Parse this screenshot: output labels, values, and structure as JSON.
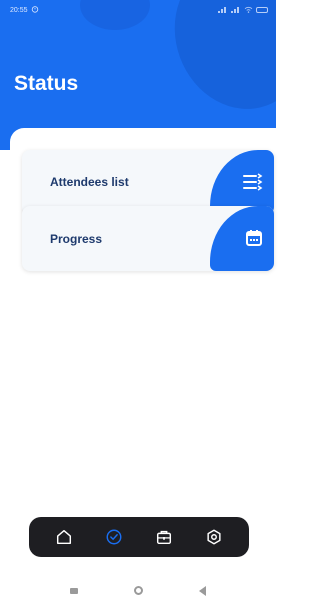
{
  "statusbar": {
    "time": "20:55"
  },
  "header": {
    "title": "Status"
  },
  "cards": [
    {
      "label": "Attendees list",
      "icon": "list-icon"
    },
    {
      "label": "Progress",
      "icon": "calendar-icon"
    }
  ],
  "bottom_nav": {
    "items": [
      {
        "icon": "home-icon"
      },
      {
        "icon": "check-circle-icon",
        "active": true
      },
      {
        "icon": "briefcase-icon"
      },
      {
        "icon": "settings-icon"
      }
    ]
  },
  "colors": {
    "accent": "#1a6ef0",
    "nav_bg": "#1e1e22",
    "card_bg": "#f5f8fb",
    "label": "#1e3a6d"
  }
}
